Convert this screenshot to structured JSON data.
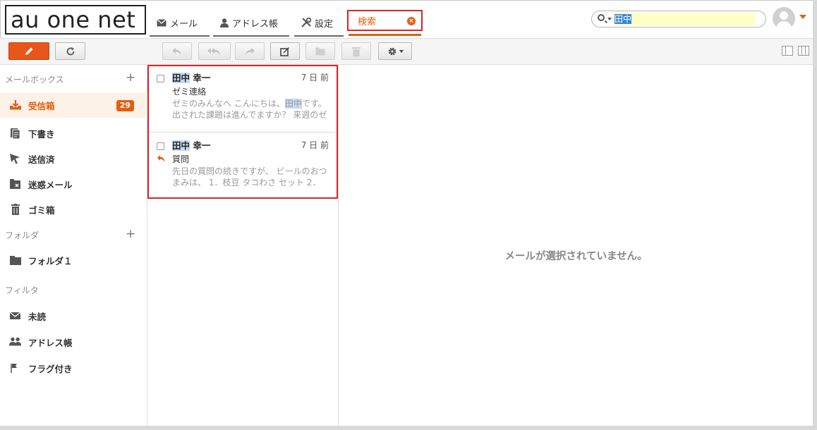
{
  "header": {
    "logo_text": "au one net",
    "nav": [
      {
        "label": "メール",
        "icon": "envelope-icon"
      },
      {
        "label": "アドレス帳",
        "icon": "person-icon"
      },
      {
        "label": "設定",
        "icon": "tools-icon"
      }
    ],
    "active_tab": {
      "label": "検索",
      "close_icon": "close-circle-icon"
    },
    "search": {
      "value": "田中",
      "icon": "search-icon"
    },
    "avatar": "user-avatar-icon"
  },
  "toolbar": {
    "compose": "pencil-icon",
    "refresh": "refresh-icon",
    "actions": [
      "reply-icon",
      "reply-all-icon",
      "forward-icon",
      "edit-icon",
      "move-folder-icon",
      "trash-icon",
      "gear-icon"
    ],
    "layout_options": [
      "single-pane-icon",
      "split-pane-icon"
    ]
  },
  "sidebar": {
    "mailbox_title": "メールボックス",
    "mailboxes": [
      {
        "label": "受信箱",
        "icon": "inbox-icon",
        "count": "29",
        "active": true
      },
      {
        "label": "下書き",
        "icon": "drafts-icon"
      },
      {
        "label": "送信済",
        "icon": "sent-icon"
      },
      {
        "label": "迷惑メール",
        "icon": "spam-icon"
      },
      {
        "label": "ゴミ箱",
        "icon": "trash-icon"
      }
    ],
    "folder_title": "フォルダ",
    "folders": [
      {
        "label": "フォルダ１",
        "icon": "folder-icon"
      }
    ],
    "filter_title": "フィルタ",
    "filters": [
      {
        "label": "未読",
        "icon": "envelope-icon"
      },
      {
        "label": "アドレス帳",
        "icon": "people-icon"
      },
      {
        "label": "フラグ付き",
        "icon": "flag-icon"
      }
    ]
  },
  "messages": [
    {
      "sender_hl": "田中",
      "sender_rest": " 幸一",
      "date": "7 日 前",
      "subject": "ゼミ連絡",
      "preview_1": "ゼミのみんなへ こんにちは、",
      "preview_hl": "田中",
      "preview_2": "です。出された課題は進んでますか？ 来週のゼ"
    },
    {
      "sender_hl": "田中",
      "sender_rest": " 幸一",
      "date": "7 日 前",
      "subject": "質問",
      "preview": "先日の質問の続きですが、 ビールのおつまみは、 1．枝豆 タコわさ セット 2．",
      "replied_icon": "replied-icon"
    }
  ],
  "reading_pane": {
    "empty_text": "メールが選択されていません。"
  }
}
